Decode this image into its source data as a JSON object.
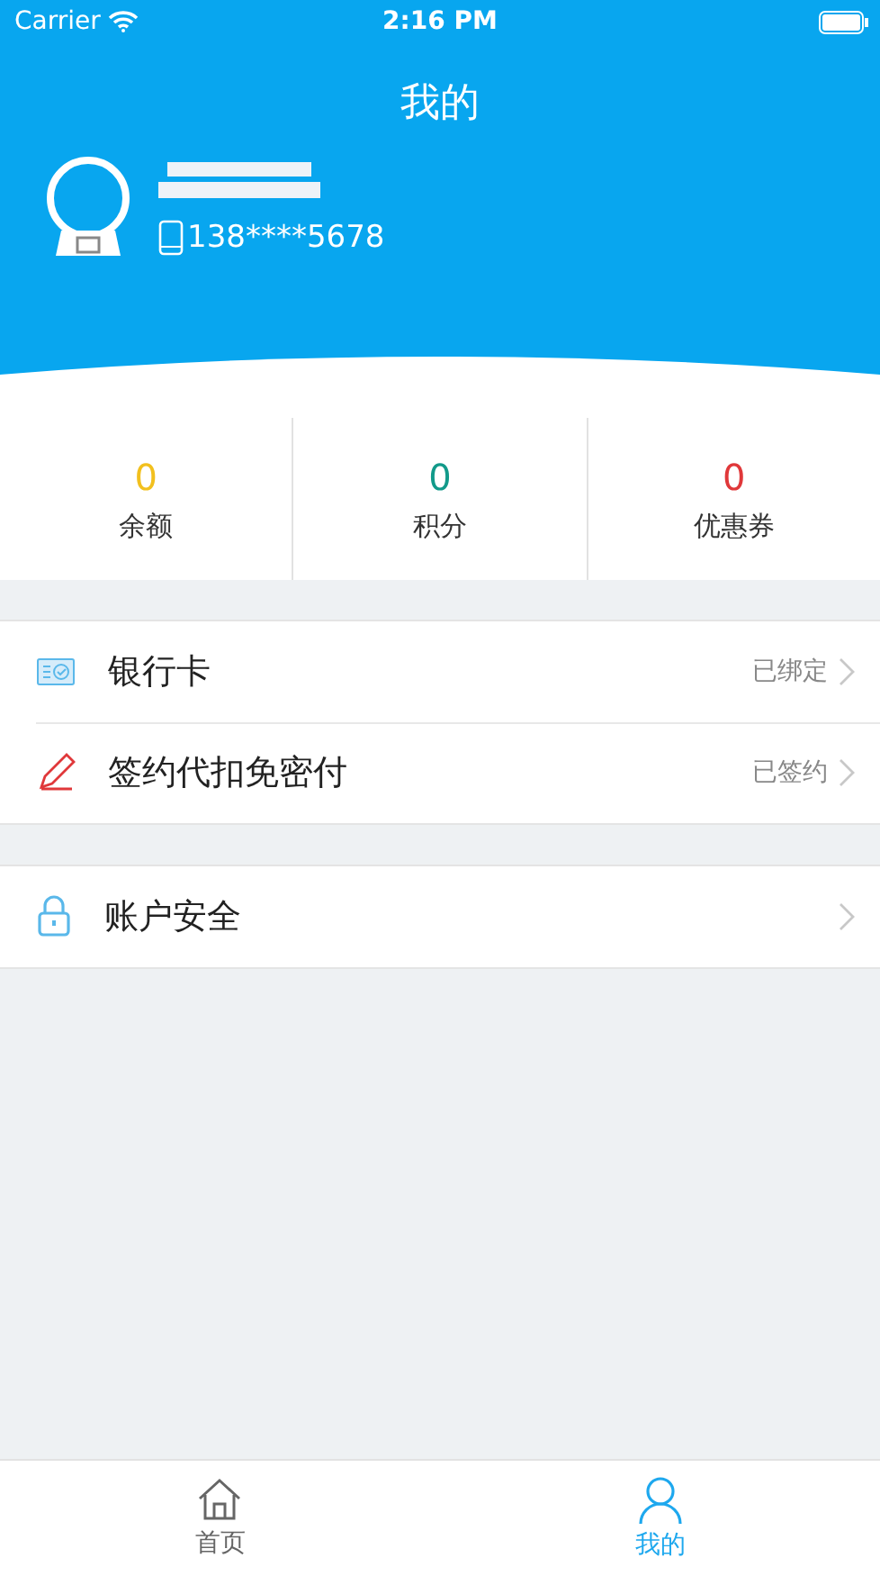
{
  "status_bar": {
    "carrier": "Carrier",
    "time": "2:16 PM"
  },
  "header": {
    "title": "我的",
    "phone": "138****5678"
  },
  "stats": [
    {
      "value": "0",
      "label": "余额",
      "color": "#f2c01e"
    },
    {
      "value": "0",
      "label": "积分",
      "color": "#129a8a"
    },
    {
      "value": "0",
      "label": "优惠券",
      "color": "#e0383a"
    }
  ],
  "menu_groups": [
    [
      {
        "kind": "card",
        "label": "银行卡",
        "status": "已绑定"
      },
      {
        "kind": "sign",
        "label": "签约代扣免密付",
        "status": "已签约"
      }
    ],
    [
      {
        "kind": "lock",
        "label": "账户安全"
      }
    ]
  ],
  "tab_bar": [
    {
      "kind": "home",
      "label": "首页",
      "selected": false
    },
    {
      "kind": "person",
      "label": "我的",
      "selected": true
    }
  ]
}
